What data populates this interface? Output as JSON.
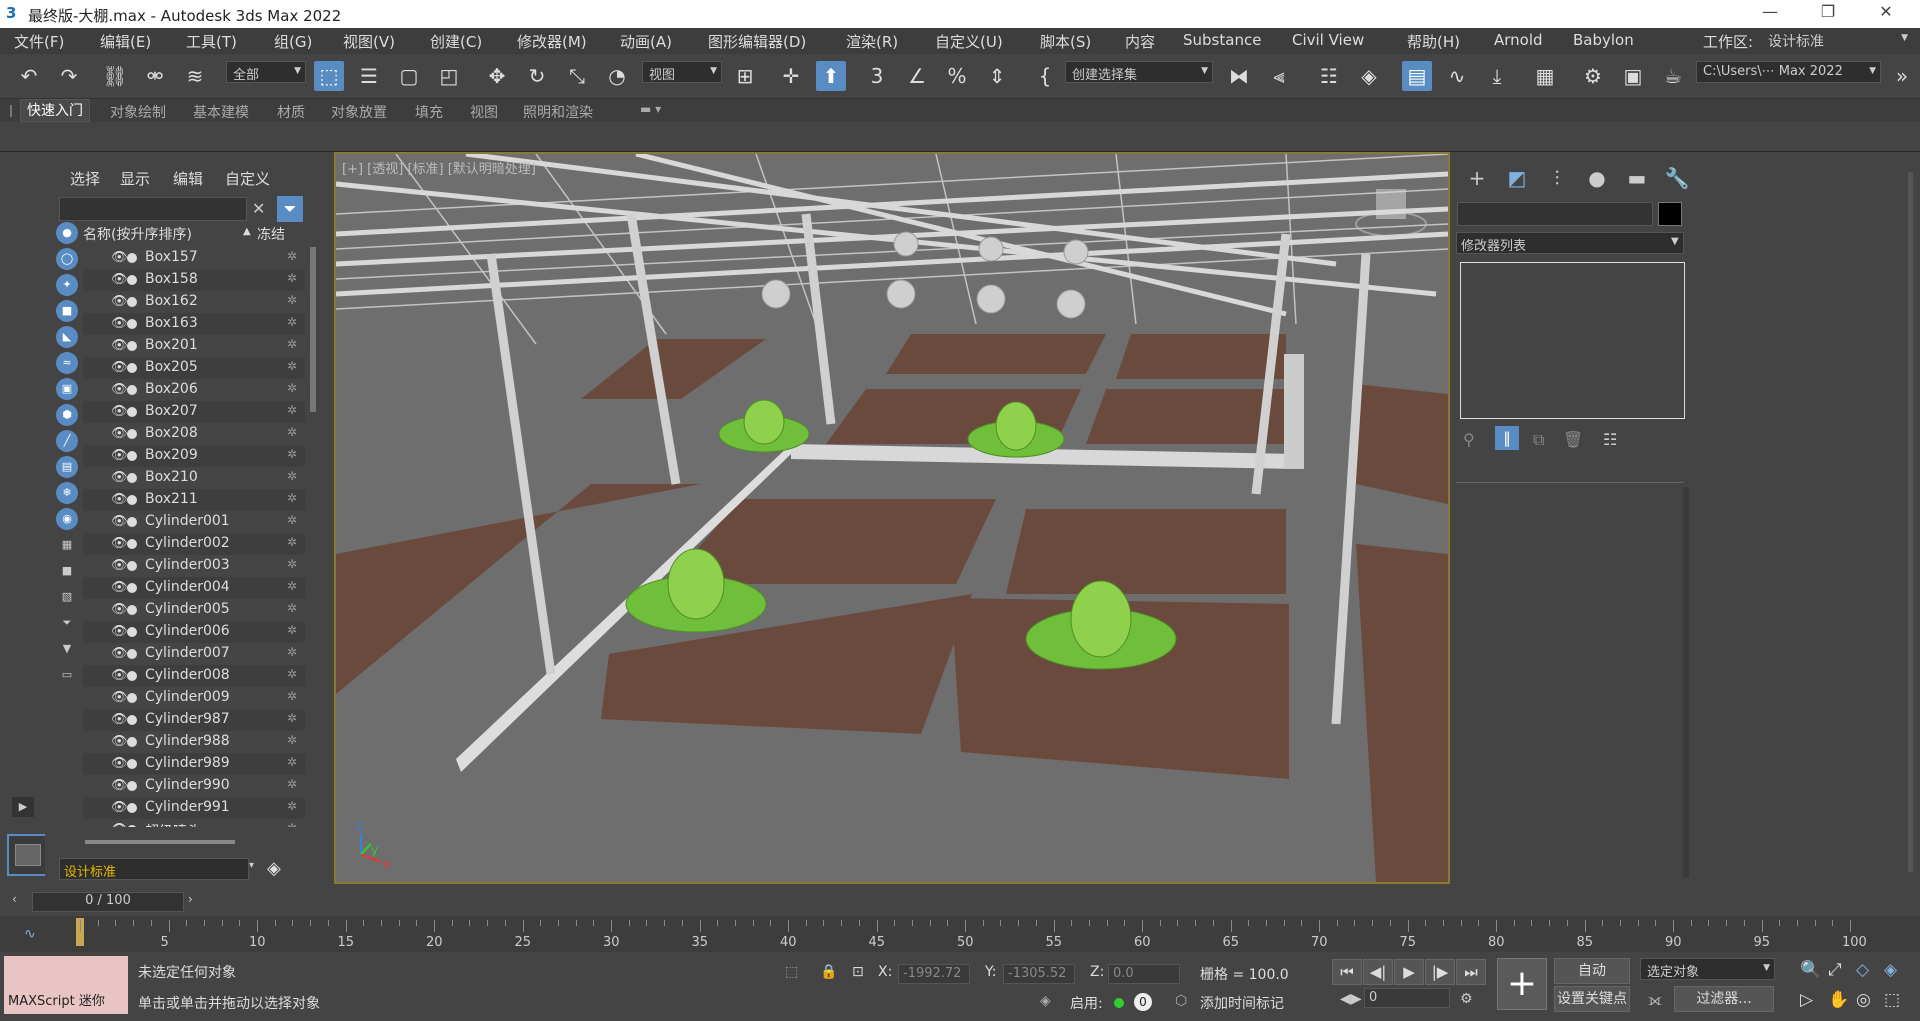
{
  "window": {
    "title": "最终版-大棚.max - Autodesk 3ds Max 2022"
  },
  "menu": [
    "文件(F)",
    "编辑(E)",
    "工具(T)",
    "组(G)",
    "视图(V)",
    "创建(C)",
    "修改器(M)",
    "动画(A)",
    "图形编辑器(D)",
    "渲染(R)",
    "自定义(U)",
    "脚本(S)",
    "内容",
    "Substance",
    "Civil View",
    "帮助(H)",
    "Arnold",
    "Babylon"
  ],
  "workspace": {
    "label": "工作区:",
    "value": "设计标准"
  },
  "toolbar": {
    "filter_value": "全部",
    "refcoord_value": "视图",
    "selset_placeholder": "创建选择集",
    "path_value": "C:\\Users\\⋯ Max 2022"
  },
  "ribbon": {
    "tabs": [
      "快速入门",
      "对象绘制",
      "基本建模",
      "材质",
      "对象放置",
      "填充",
      "视图",
      "照明和渲染"
    ]
  },
  "explorer": {
    "tabs": [
      "选择",
      "显示",
      "编辑",
      "自定义"
    ],
    "col_name": "名称(按升序排序)",
    "col_freeze": "冻结",
    "items": [
      "Box157",
      "Box158",
      "Box162",
      "Box163",
      "Box201",
      "Box205",
      "Box206",
      "Box207",
      "Box208",
      "Box209",
      "Box210",
      "Box211",
      "Cylinder001",
      "Cylinder002",
      "Cylinder003",
      "Cylinder004",
      "Cylinder005",
      "Cylinder006",
      "Cylinder007",
      "Cylinder008",
      "Cylinder009",
      "Cylinder987",
      "Cylinder988",
      "Cylinder989",
      "Cylinder990",
      "Cylinder991",
      "超级喷头"
    ],
    "workspace_value": "设计标准"
  },
  "viewport": {
    "label": "[+] [透视] [标准] [默认明暗处理]"
  },
  "command_panel": {
    "modifier_list": "修改器列表"
  },
  "timeline": {
    "frame": "0 / 100",
    "ticks": [
      "5",
      "10",
      "15",
      "20",
      "25",
      "30",
      "35",
      "40",
      "45",
      "50",
      "55",
      "60",
      "65",
      "70",
      "75",
      "80",
      "85",
      "90",
      "95",
      "100"
    ]
  },
  "status": {
    "maxscript": "MAXScript 迷你",
    "line1": "未选定任何对象",
    "line2": "单击或单击并拖动以选择对象",
    "x_label": "X:",
    "x_value": "-1992.72",
    "y_label": "Y:",
    "y_value": "-1305.52",
    "z_label": "Z:",
    "z_value": "0.0",
    "grid": "栅格 = 100.0",
    "enable": "启用:",
    "enable_value": "0",
    "add_time_tag": "添加时间标记",
    "auto": "自动",
    "set_key": "设置关键点",
    "key_filter": "选定对象",
    "filters": "过滤器...",
    "frame_input": "0"
  }
}
